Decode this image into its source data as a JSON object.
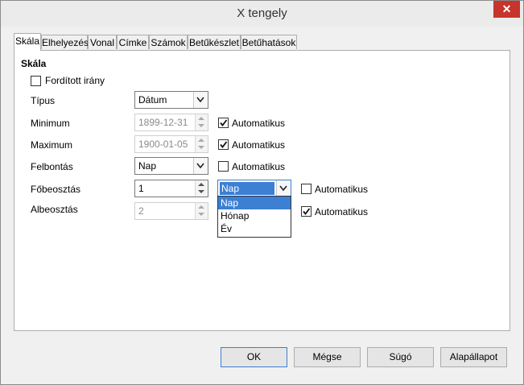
{
  "window": {
    "title": "X tengely",
    "close_glyph": "✕"
  },
  "tabs": [
    "Skála",
    "Elhelyezés",
    "Vonal",
    "Címke",
    "Számok",
    "Betűkészlet",
    "Betűhatások"
  ],
  "scale": {
    "section_title": "Skála",
    "reverse_label": "Fordított irány",
    "type_label": "Típus",
    "type_value": "Dátum",
    "minimum_label": "Minimum",
    "minimum_value": "1899-12-31",
    "maximum_label": "Maximum",
    "maximum_value": "1900-01-05",
    "resolution_label": "Felbontás",
    "resolution_value": "Nap",
    "major_label": "Főbeosztás",
    "major_value": "1",
    "major_unit": "Nap",
    "minor_label": "Albeosztás",
    "minor_value": "2",
    "auto_label": "Automatikus",
    "auto_states": {
      "minimum": true,
      "maximum": true,
      "resolution": false,
      "major": false,
      "minor": true
    }
  },
  "dropdown_options": [
    "Nap",
    "Hónap",
    "Év"
  ],
  "buttons": {
    "ok": "OK",
    "cancel": "Mégse",
    "help": "Súgó",
    "reset": "Alapállapot"
  },
  "colors": {
    "close": "#c7342c",
    "selection": "#3c7fd3"
  }
}
